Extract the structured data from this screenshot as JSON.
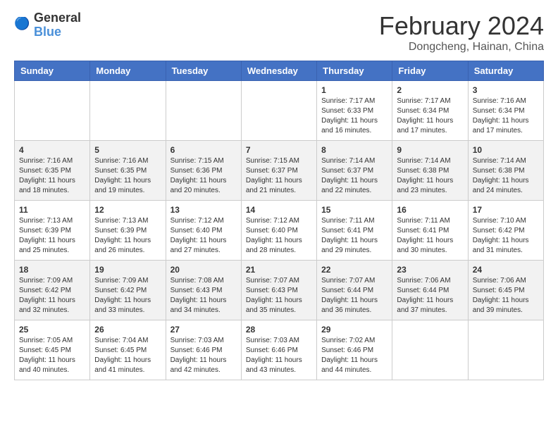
{
  "header": {
    "logo_general": "General",
    "logo_blue": "Blue",
    "month_year": "February 2024",
    "location": "Dongcheng, Hainan, China"
  },
  "weekdays": [
    "Sunday",
    "Monday",
    "Tuesday",
    "Wednesday",
    "Thursday",
    "Friday",
    "Saturday"
  ],
  "weeks": [
    [
      {
        "day": "",
        "info": ""
      },
      {
        "day": "",
        "info": ""
      },
      {
        "day": "",
        "info": ""
      },
      {
        "day": "",
        "info": ""
      },
      {
        "day": "1",
        "info": "Sunrise: 7:17 AM\nSunset: 6:33 PM\nDaylight: 11 hours and 16 minutes."
      },
      {
        "day": "2",
        "info": "Sunrise: 7:17 AM\nSunset: 6:34 PM\nDaylight: 11 hours and 17 minutes."
      },
      {
        "day": "3",
        "info": "Sunrise: 7:16 AM\nSunset: 6:34 PM\nDaylight: 11 hours and 17 minutes."
      }
    ],
    [
      {
        "day": "4",
        "info": "Sunrise: 7:16 AM\nSunset: 6:35 PM\nDaylight: 11 hours and 18 minutes."
      },
      {
        "day": "5",
        "info": "Sunrise: 7:16 AM\nSunset: 6:35 PM\nDaylight: 11 hours and 19 minutes."
      },
      {
        "day": "6",
        "info": "Sunrise: 7:15 AM\nSunset: 6:36 PM\nDaylight: 11 hours and 20 minutes."
      },
      {
        "day": "7",
        "info": "Sunrise: 7:15 AM\nSunset: 6:37 PM\nDaylight: 11 hours and 21 minutes."
      },
      {
        "day": "8",
        "info": "Sunrise: 7:14 AM\nSunset: 6:37 PM\nDaylight: 11 hours and 22 minutes."
      },
      {
        "day": "9",
        "info": "Sunrise: 7:14 AM\nSunset: 6:38 PM\nDaylight: 11 hours and 23 minutes."
      },
      {
        "day": "10",
        "info": "Sunrise: 7:14 AM\nSunset: 6:38 PM\nDaylight: 11 hours and 24 minutes."
      }
    ],
    [
      {
        "day": "11",
        "info": "Sunrise: 7:13 AM\nSunset: 6:39 PM\nDaylight: 11 hours and 25 minutes."
      },
      {
        "day": "12",
        "info": "Sunrise: 7:13 AM\nSunset: 6:39 PM\nDaylight: 11 hours and 26 minutes."
      },
      {
        "day": "13",
        "info": "Sunrise: 7:12 AM\nSunset: 6:40 PM\nDaylight: 11 hours and 27 minutes."
      },
      {
        "day": "14",
        "info": "Sunrise: 7:12 AM\nSunset: 6:40 PM\nDaylight: 11 hours and 28 minutes."
      },
      {
        "day": "15",
        "info": "Sunrise: 7:11 AM\nSunset: 6:41 PM\nDaylight: 11 hours and 29 minutes."
      },
      {
        "day": "16",
        "info": "Sunrise: 7:11 AM\nSunset: 6:41 PM\nDaylight: 11 hours and 30 minutes."
      },
      {
        "day": "17",
        "info": "Sunrise: 7:10 AM\nSunset: 6:42 PM\nDaylight: 11 hours and 31 minutes."
      }
    ],
    [
      {
        "day": "18",
        "info": "Sunrise: 7:09 AM\nSunset: 6:42 PM\nDaylight: 11 hours and 32 minutes."
      },
      {
        "day": "19",
        "info": "Sunrise: 7:09 AM\nSunset: 6:42 PM\nDaylight: 11 hours and 33 minutes."
      },
      {
        "day": "20",
        "info": "Sunrise: 7:08 AM\nSunset: 6:43 PM\nDaylight: 11 hours and 34 minutes."
      },
      {
        "day": "21",
        "info": "Sunrise: 7:07 AM\nSunset: 6:43 PM\nDaylight: 11 hours and 35 minutes."
      },
      {
        "day": "22",
        "info": "Sunrise: 7:07 AM\nSunset: 6:44 PM\nDaylight: 11 hours and 36 minutes."
      },
      {
        "day": "23",
        "info": "Sunrise: 7:06 AM\nSunset: 6:44 PM\nDaylight: 11 hours and 37 minutes."
      },
      {
        "day": "24",
        "info": "Sunrise: 7:06 AM\nSunset: 6:45 PM\nDaylight: 11 hours and 39 minutes."
      }
    ],
    [
      {
        "day": "25",
        "info": "Sunrise: 7:05 AM\nSunset: 6:45 PM\nDaylight: 11 hours and 40 minutes."
      },
      {
        "day": "26",
        "info": "Sunrise: 7:04 AM\nSunset: 6:45 PM\nDaylight: 11 hours and 41 minutes."
      },
      {
        "day": "27",
        "info": "Sunrise: 7:03 AM\nSunset: 6:46 PM\nDaylight: 11 hours and 42 minutes."
      },
      {
        "day": "28",
        "info": "Sunrise: 7:03 AM\nSunset: 6:46 PM\nDaylight: 11 hours and 43 minutes."
      },
      {
        "day": "29",
        "info": "Sunrise: 7:02 AM\nSunset: 6:46 PM\nDaylight: 11 hours and 44 minutes."
      },
      {
        "day": "",
        "info": ""
      },
      {
        "day": "",
        "info": ""
      }
    ]
  ]
}
